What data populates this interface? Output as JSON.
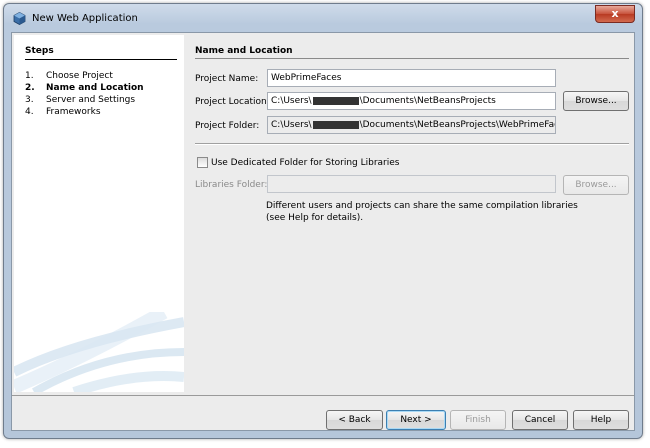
{
  "window": {
    "title": "New Web Application",
    "close_glyph": "x"
  },
  "steps": {
    "title": "Steps",
    "items": [
      {
        "num": "1.",
        "label": "Choose Project"
      },
      {
        "num": "2.",
        "label": "Name and Location"
      },
      {
        "num": "3.",
        "label": "Server and Settings"
      },
      {
        "num": "4.",
        "label": "Frameworks"
      }
    ]
  },
  "panel": {
    "title": "Name and Location",
    "project_name_label": "Project Name:",
    "project_name_value": "WebPrimeFaces",
    "project_location_label": "Project Location:",
    "project_location_prefix": "C:\\Users\\",
    "project_location_suffix": "\\Documents\\NetBeansProjects",
    "browse_label": "Browse...",
    "project_folder_label": "Project Folder:",
    "project_folder_prefix": "C:\\Users\\",
    "project_folder_suffix": "\\Documents\\NetBeansProjects\\WebPrimeFaces",
    "dedicated_folder_label": "Use Dedicated Folder for Storing Libraries",
    "libraries_folder_label": "Libraries Folder:",
    "libraries_folder_value": "",
    "libraries_browse_label": "Browse...",
    "help_line1": "Different users and projects can share the same compilation libraries",
    "help_line2": "(see Help for details)."
  },
  "buttons": {
    "back": "< Back",
    "next": "Next >",
    "finish": "Finish",
    "cancel": "Cancel",
    "help": "Help"
  },
  "colors": {
    "frame": "#b9cade",
    "close": "#c7513b",
    "panel_bg": "#ececec"
  },
  "icons": {
    "app": "netbeans-cube-icon",
    "close": "close-icon",
    "checkbox": "checkbox-unchecked"
  }
}
